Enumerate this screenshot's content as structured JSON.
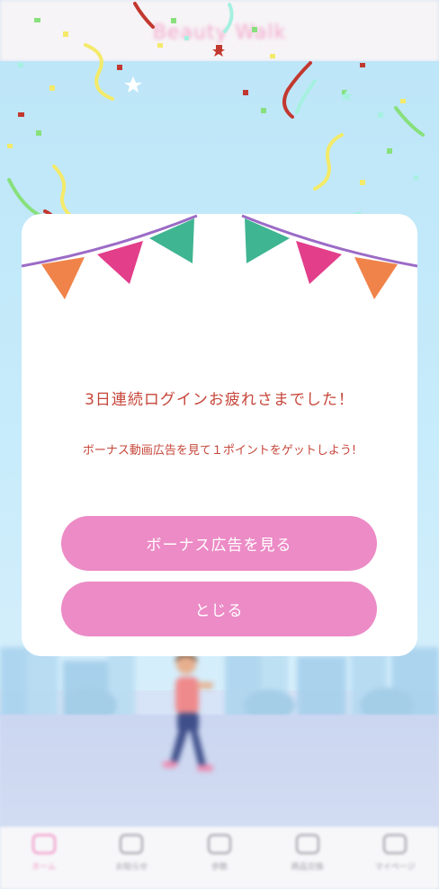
{
  "app": {
    "logo_text": "Beauty Walk"
  },
  "modal": {
    "title": "3日連続ログインお疲れさまでした！",
    "subtitle": "ボーナス動画広告を見て１ポイントをゲットしよう!",
    "watch_ad_label": "ボーナス広告を見る",
    "close_label": "とじる"
  },
  "tabbar": {
    "items": [
      {
        "label": "ホーム",
        "icon": "home-icon",
        "active": true
      },
      {
        "label": "お知らせ",
        "icon": "mail-icon",
        "active": false
      },
      {
        "label": "歩数",
        "icon": "steps-icon",
        "active": false
      },
      {
        "label": "商品交換",
        "icon": "gift-icon",
        "active": false
      },
      {
        "label": "マイページ",
        "icon": "user-icon",
        "active": false
      }
    ]
  },
  "colors": {
    "accent_pink": "#ec8bc6",
    "message_red": "#c6463a",
    "flag_green": "#3fb592",
    "flag_magenta": "#e23e8a",
    "flag_orange": "#f0834a",
    "string_purple": "#9b6bc6"
  }
}
